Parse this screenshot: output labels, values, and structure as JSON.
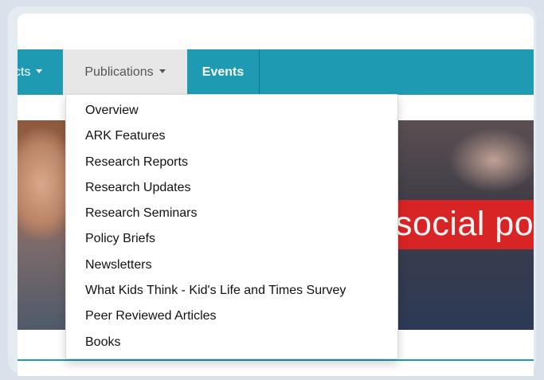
{
  "navbar": {
    "items": [
      {
        "label": "cts",
        "has_caret": true
      },
      {
        "label": "Publications",
        "has_caret": true,
        "active": true
      },
      {
        "label": "Events",
        "has_caret": false
      }
    ],
    "colors": {
      "background": "#1e9bb3",
      "active_background": "#e7e7e7",
      "active_text": "#555555",
      "text": "#ffffff"
    }
  },
  "dropdown": {
    "items": [
      "Overview",
      "ARK Features",
      "Research Reports",
      "Research Updates",
      "Research Seminars",
      "Policy Briefs",
      "Newsletters",
      "What Kids Think - Kid's Life and Times Survey",
      "Peer Reviewed Articles",
      "Books"
    ]
  },
  "banner": {
    "caption": "social po",
    "caption_color": "#d82424"
  }
}
